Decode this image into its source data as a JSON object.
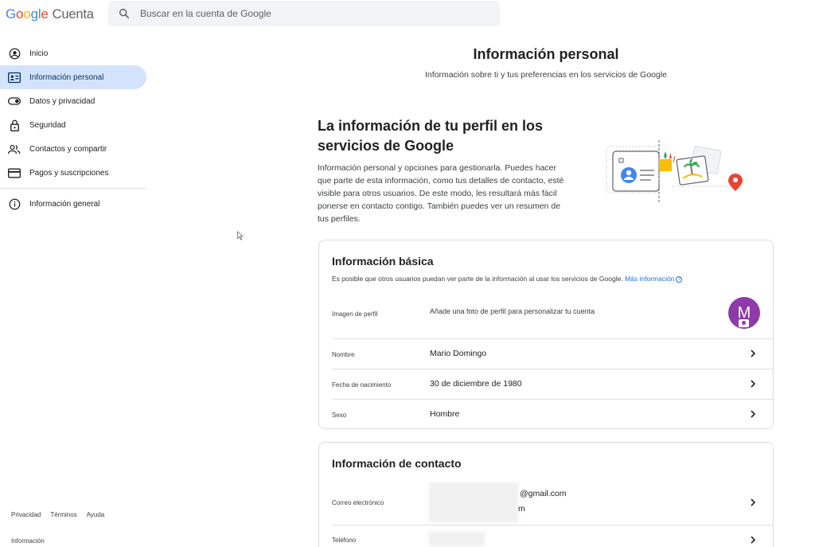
{
  "header": {
    "logo_letters": [
      {
        "ch": "G",
        "color": "#4285f4"
      },
      {
        "ch": "o",
        "color": "#ea4335"
      },
      {
        "ch": "o",
        "color": "#fbbc05"
      },
      {
        "ch": "g",
        "color": "#4285f4"
      },
      {
        "ch": "l",
        "color": "#34a853"
      },
      {
        "ch": "e",
        "color": "#ea4335"
      }
    ],
    "product": "Cuenta",
    "search_placeholder": "Buscar en la cuenta de Google"
  },
  "sidebar": {
    "items": [
      {
        "label": "Inicio",
        "icon": "account-circle-icon"
      },
      {
        "label": "Información personal",
        "icon": "id-card-icon",
        "active": true
      },
      {
        "label": "Datos y privacidad",
        "icon": "toggle-icon"
      },
      {
        "label": "Seguridad",
        "icon": "lock-icon"
      },
      {
        "label": "Contactos y compartir",
        "icon": "people-icon"
      },
      {
        "label": "Pagos y suscripciones",
        "icon": "credit-card-icon"
      }
    ],
    "secondary": [
      {
        "label": "Información general",
        "icon": "info-icon"
      }
    ],
    "footer_links": [
      "Privacidad",
      "Términos",
      "Ayuda"
    ],
    "footer_info": "Información"
  },
  "main": {
    "title": "Información personal",
    "subtitle": "Información sobre ti y tus preferencias en los servicios de Google",
    "intro": {
      "title": "La información de tu perfil en los servicios de Google",
      "text": "Información personal y opciones para gestionarla. Puedes hacer que parte de esta información, como tus detalles de contacto, esté visible para otros usuarios. De este modo, les resultará más fácil ponerse en contacto contigo. También puedes ver un resumen de tus perfiles."
    },
    "basic": {
      "title": "Información básica",
      "description": "Es posible que otros usuarios puedan ver parte de la información al usar los servicios de Google.",
      "more_link": "Más información",
      "photo_label": "Imagen de perfil",
      "photo_hint": "Añade una foto de perfil para personalizar tu cuenta",
      "avatar_letter": "M",
      "avatar_color": "#8e3aa8",
      "rows": [
        {
          "label": "Nombre",
          "value": "Mario Domingo"
        },
        {
          "label": "Fecha de nacimiento",
          "value": "30 de diciembre de 1980"
        },
        {
          "label": "Sexo",
          "value": "Hombre"
        }
      ]
    },
    "contact": {
      "title": "Información de contacto",
      "email_label": "Correo electrónico",
      "email_values": [
        "@gmail.com",
        "m"
      ],
      "phone_label": "Teléfono"
    }
  },
  "colors": {
    "accent": "#1a73e8",
    "active_bg": "#d3e3fd"
  }
}
